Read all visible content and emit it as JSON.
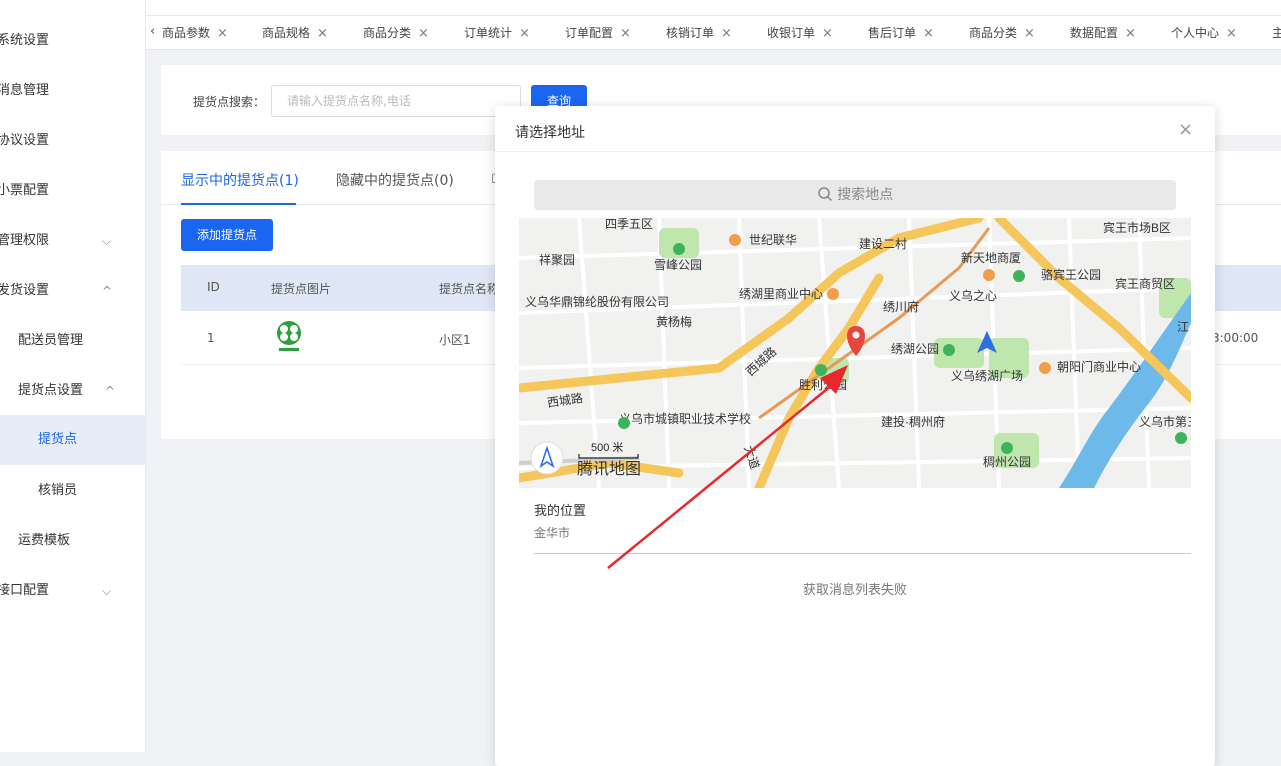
{
  "sidebar": {
    "items": [
      {
        "label": "系统设置"
      },
      {
        "label": "消息管理"
      },
      {
        "label": "协议设置"
      },
      {
        "label": "小票配置"
      },
      {
        "label": "管理权限"
      },
      {
        "label": "发货设置"
      },
      {
        "label": "配送员管理"
      },
      {
        "label": "提货点设置"
      },
      {
        "label": "提货点"
      },
      {
        "label": "核销员"
      },
      {
        "label": "运费模板"
      },
      {
        "label": "接口配置"
      }
    ]
  },
  "tabs": [
    {
      "label": "商品参数"
    },
    {
      "label": "商品规格"
    },
    {
      "label": "商品分类"
    },
    {
      "label": "订单统计"
    },
    {
      "label": "订单配置"
    },
    {
      "label": "核销订单"
    },
    {
      "label": "收银订单"
    },
    {
      "label": "售后订单"
    },
    {
      "label": "商品分类"
    },
    {
      "label": "数据配置"
    },
    {
      "label": "个人中心"
    },
    {
      "label": "主"
    }
  ],
  "search": {
    "label": "提货点搜索：",
    "placeholder": "请输入提货点名称,电话",
    "button": "查询"
  },
  "content_tabs": {
    "shown": "显示中的提货点(1)",
    "hidden": "隐藏中的提货点(0)"
  },
  "add_button": "添加提货点",
  "table": {
    "headers": [
      "ID",
      "提货点图片",
      "提货点名称"
    ],
    "rows": [
      {
        "id": "1",
        "name": "小区1",
        "time": "3:00:00"
      }
    ]
  },
  "modal": {
    "title": "请选择地址",
    "search_placeholder": "搜索地点",
    "my_location_label": "我的位置",
    "my_location_city": "金华市",
    "empty_message": "获取消息列表失败"
  },
  "map": {
    "brand": "腾讯地图",
    "scale": "500 米",
    "labels": [
      "四季五区",
      "世纪联华",
      "建设二村",
      "宾王市场B区",
      "祥聚园",
      "雪峰公园",
      "新天地商厦",
      "骆宾王公园",
      "宾王商贸区",
      "义乌华鼎锦纶股份有限公司",
      "绣湖里商业中心",
      "义乌之心",
      "黄杨梅",
      "绣川府",
      "江",
      "西城路",
      "绣湖公园",
      "义乌绣湖广场",
      "朝阳门商业中心",
      "胜利公园",
      "西城路",
      "义乌市城镇职业技术学校",
      "建投·稠州府",
      "义乌市第三",
      "稠州公园",
      "大道"
    ]
  },
  "colors": {
    "primary": "#1a66f0",
    "road_major": "#f7c95e",
    "park": "#b5e2a1",
    "water": "#5fb2e8",
    "marker": "#e8453c",
    "annotation_arrow": "#e8282b"
  }
}
